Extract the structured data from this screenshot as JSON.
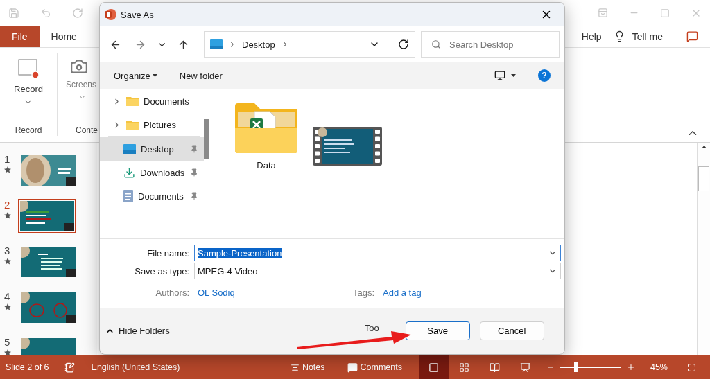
{
  "app": {
    "tabs": [
      {
        "label": "File",
        "kind": "file",
        "selected": false
      },
      {
        "label": "Home",
        "kind": "tab",
        "selected": false
      }
    ],
    "right_tabs": [
      "Help"
    ],
    "tell_me": "Tell me",
    "ribbon": {
      "groups": [
        {
          "label": "Record",
          "button": "Record",
          "kind": "record"
        },
        {
          "label": "Conte",
          "button": "Screens",
          "kind": "screenshot"
        }
      ]
    }
  },
  "slides": [
    {
      "number": "1",
      "selected": false
    },
    {
      "number": "2",
      "selected": true
    },
    {
      "number": "3",
      "selected": false
    },
    {
      "number": "4",
      "selected": false
    },
    {
      "number": "5",
      "selected": false
    }
  ],
  "dialog": {
    "title": "Save As",
    "path": [
      "Desktop"
    ],
    "search": {
      "placeholder": "Search Desktop"
    },
    "toolbar": {
      "organize": "Organize",
      "new_folder": "New folder",
      "help": "?"
    },
    "nav": {
      "folders": [
        {
          "label": "Documents",
          "kind": "folder",
          "selected": false
        },
        {
          "label": "Pictures",
          "kind": "folder",
          "selected": false
        }
      ],
      "pinned": [
        {
          "label": "Desktop",
          "kind": "desktop",
          "selected": true
        },
        {
          "label": "Downloads",
          "kind": "downloads",
          "selected": false
        },
        {
          "label": "Documents",
          "kind": "documents",
          "selected": false
        }
      ]
    },
    "files": [
      {
        "name": "Data",
        "kind": "folder"
      },
      {
        "kind": "video"
      }
    ],
    "file_name": {
      "label": "File name:",
      "value": "Sample-Presentation",
      "text_selected": true
    },
    "save_as_type": {
      "label": "Save as type:",
      "value": "MPEG-4 Video"
    },
    "authors": {
      "label": "Authors:",
      "value": "OL Sodiq"
    },
    "tags": {
      "label": "Tags:",
      "value": "Add a tag"
    },
    "hide_folders": "Hide Folders",
    "tools": "Too",
    "buttons": [
      {
        "label": "Save",
        "default": true
      },
      {
        "label": "Cancel",
        "default": false
      }
    ]
  },
  "status_bar": {
    "slide": "Slide 2 of 6",
    "language": "English (United States)",
    "notes": "Notes",
    "comments": "Comments",
    "views": [
      {
        "kind": "normal",
        "selected": true
      },
      {
        "kind": "sorter",
        "selected": false
      },
      {
        "kind": "reading",
        "selected": false
      },
      {
        "kind": "slideshow",
        "selected": false
      }
    ],
    "zoom": {
      "level": 0.25,
      "reading": "45%"
    }
  }
}
